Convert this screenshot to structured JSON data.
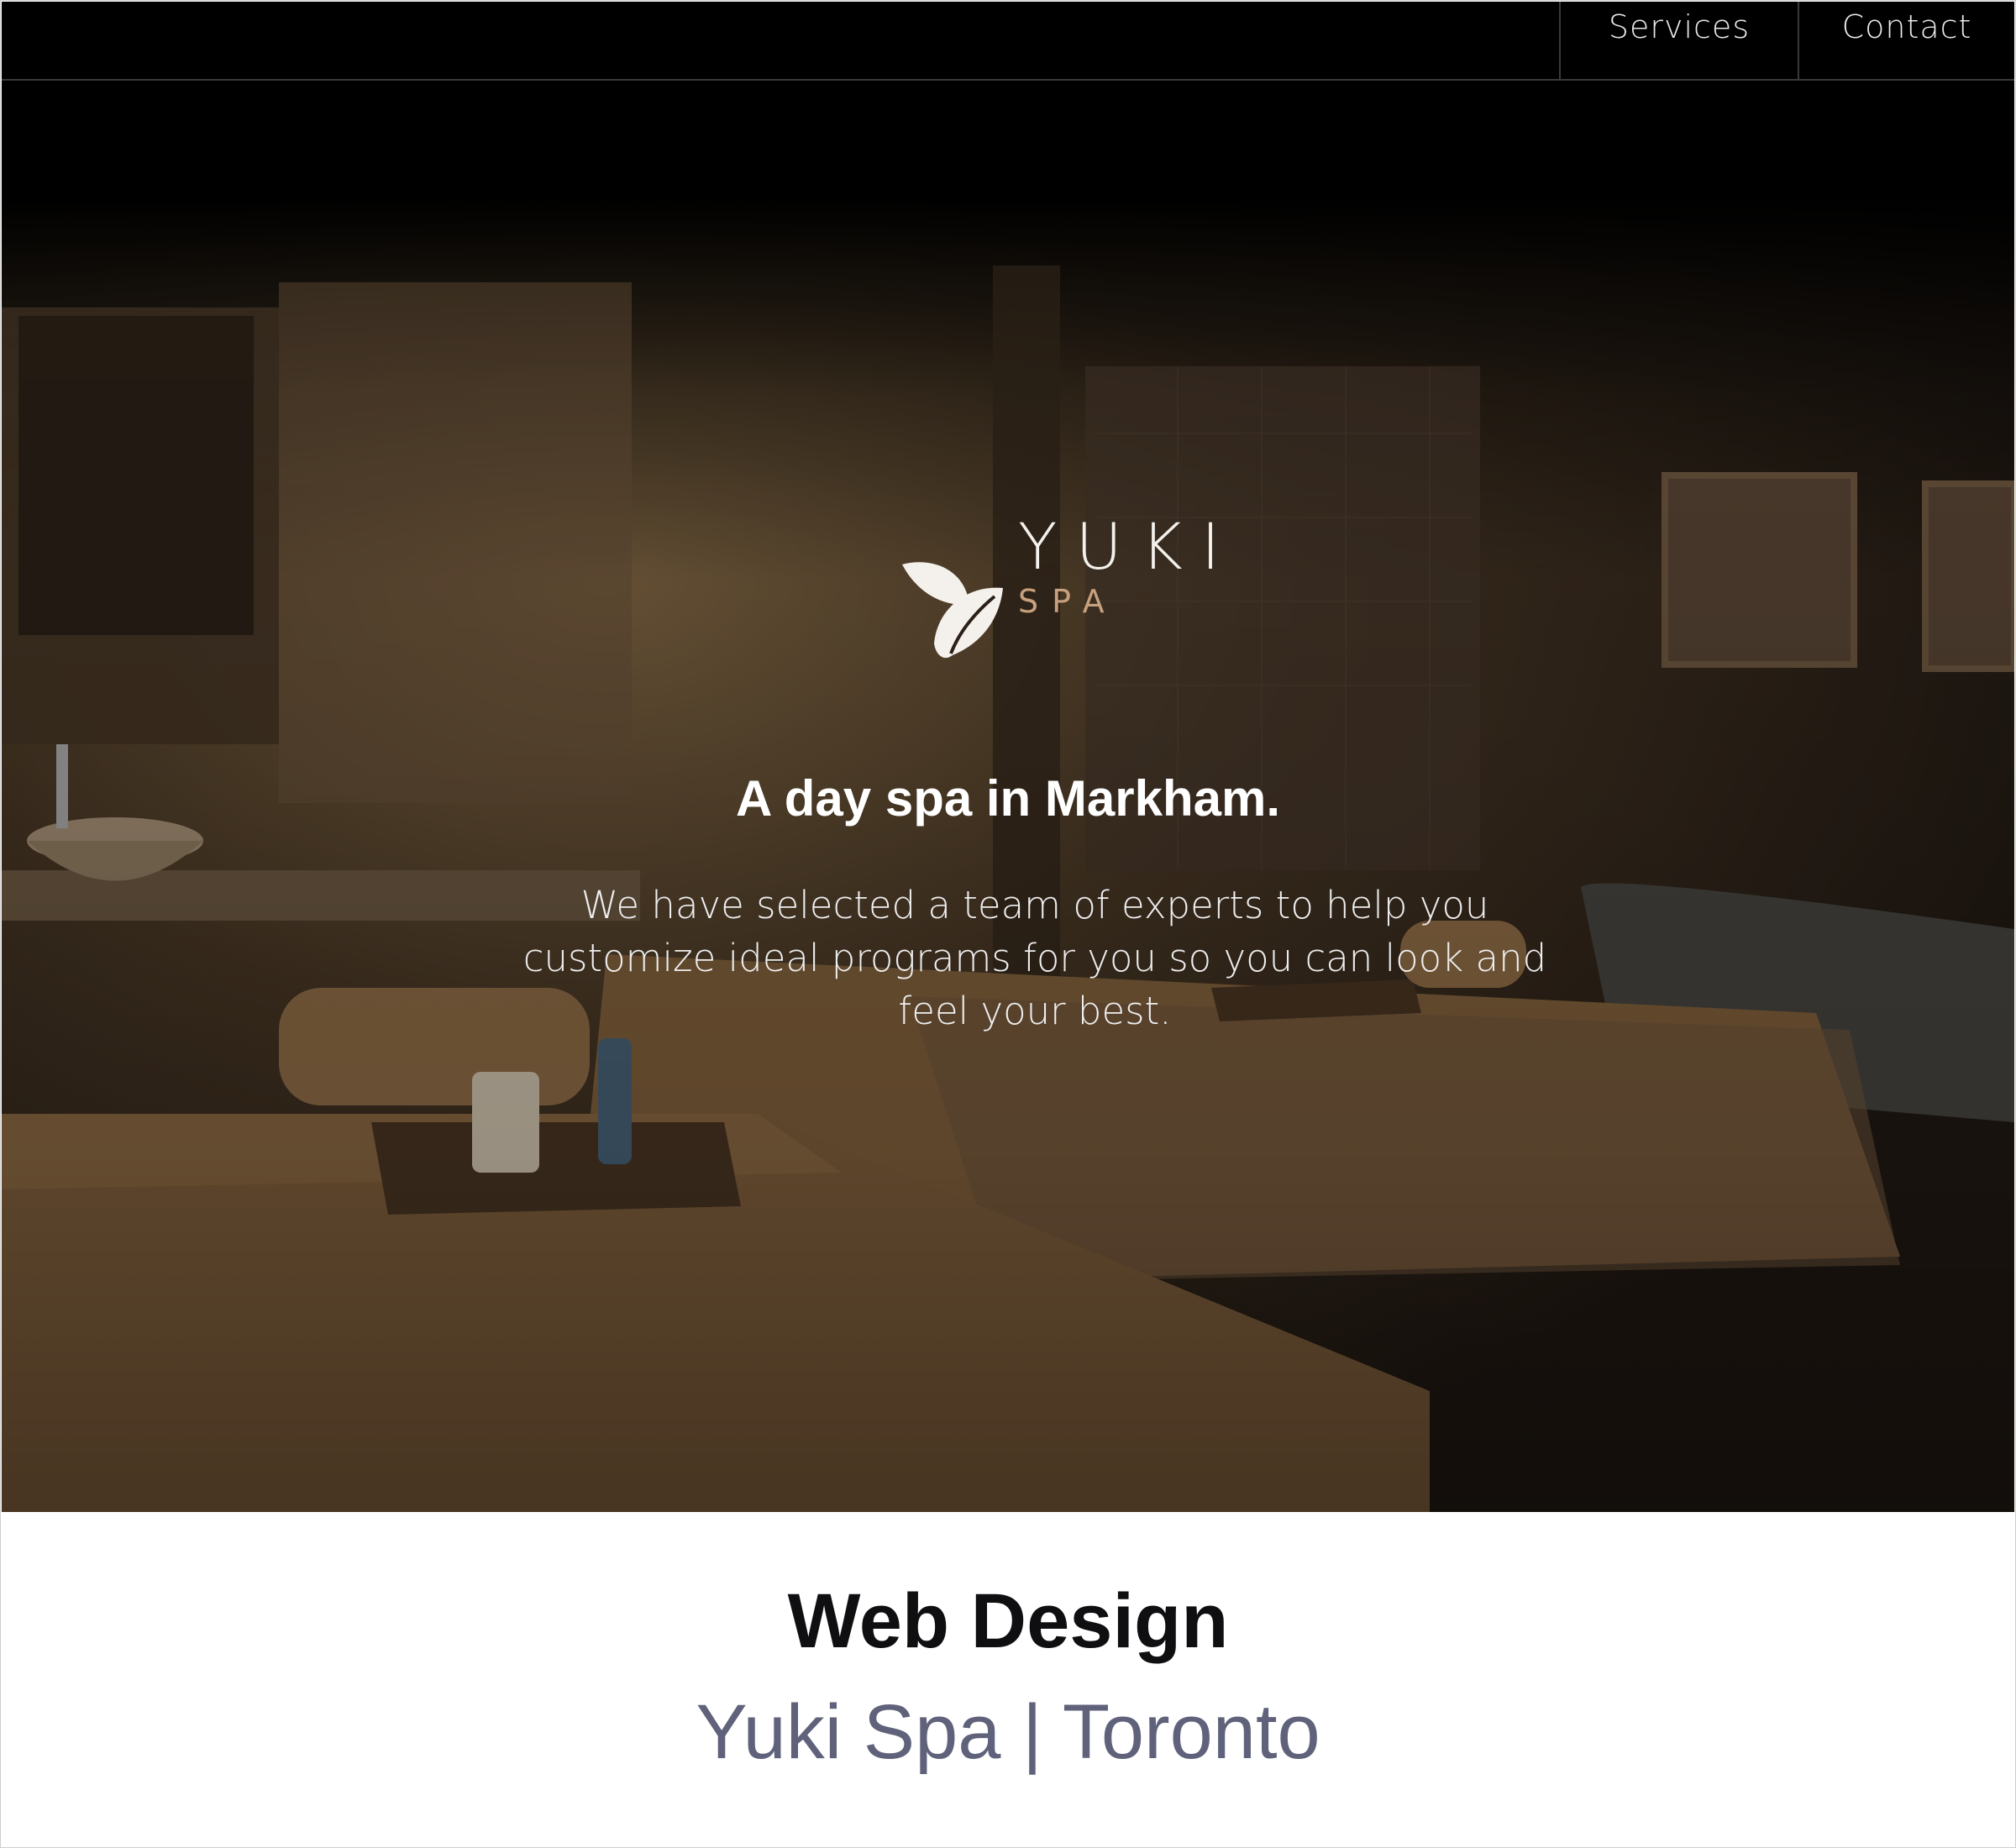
{
  "nav": {
    "items": [
      {
        "label": "Services"
      },
      {
        "label": "Contact"
      }
    ]
  },
  "hero": {
    "logo": {
      "word": "YUKI",
      "sub": "SPA"
    },
    "title": "A day spa in Markham.",
    "description": "We have selected a team of experts to help you customize ideal programs for you so you can look and feel your best."
  },
  "caption": {
    "title": "Web Design",
    "subtitle": "Yuki Spa | Toronto"
  },
  "colors": {
    "nav_bg": "#000000",
    "logo_accent": "#c7a07d",
    "subtitle": "#5f627a"
  }
}
